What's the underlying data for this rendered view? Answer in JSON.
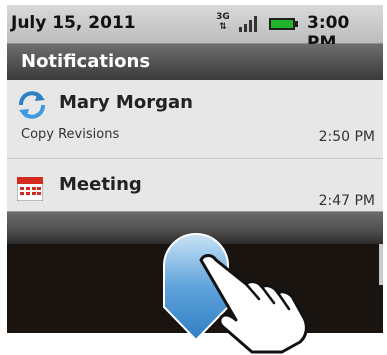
{
  "status_bar": {
    "date": "July 15, 2011",
    "network": "3G",
    "time": "3:00 PM",
    "battery_color": "#22b32c"
  },
  "notifications": {
    "header": "Notifications",
    "items": [
      {
        "title": "Mary Morgan",
        "subtitle": "Copy Revisions",
        "time": "2:50 PM",
        "icon": "sync-icon"
      },
      {
        "title": "Meeting",
        "time": "2:47 PM",
        "icon": "calendar-icon"
      }
    ]
  },
  "gesture": {
    "description_icons": [
      "swipe-down-arrow-icon",
      "pointing-hand-icon"
    ],
    "arrow_color": "#5fa3db"
  }
}
